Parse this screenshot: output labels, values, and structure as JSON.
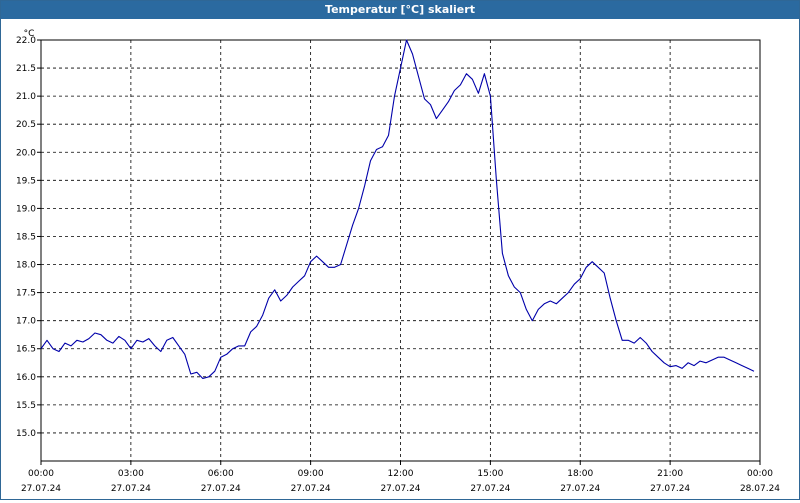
{
  "window": {
    "title": "Temperatur [°C] skaliert"
  },
  "chart_data": {
    "type": "line",
    "title": "Temperatur [°C] skaliert",
    "ylabel": "°C",
    "xlabel": "",
    "ylim": [
      14.5,
      22.0
    ],
    "yticks": [
      15.0,
      15.5,
      16.0,
      16.5,
      17.0,
      17.5,
      18.0,
      18.5,
      19.0,
      19.5,
      20.0,
      20.5,
      21.0,
      21.5,
      22.0
    ],
    "xlim": [
      0,
      24
    ],
    "xticks": [
      {
        "time": "00:00",
        "date": "27.07.24"
      },
      {
        "time": "03:00",
        "date": "27.07.24"
      },
      {
        "time": "06:00",
        "date": "27.07.24"
      },
      {
        "time": "09:00",
        "date": "27.07.24"
      },
      {
        "time": "12:00",
        "date": "27.07.24"
      },
      {
        "time": "15:00",
        "date": "27.07.24"
      },
      {
        "time": "18:00",
        "date": "27.07.24"
      },
      {
        "time": "21:00",
        "date": "27.07.24"
      },
      {
        "time": "00:00",
        "date": "28.07.24"
      }
    ],
    "grid": true,
    "line_color": "#0000aa",
    "series": [
      {
        "x": [
          0.0,
          0.2,
          0.4,
          0.6,
          0.8,
          1.0,
          1.2,
          1.4,
          1.6,
          1.8,
          2.0,
          2.2,
          2.4,
          2.6,
          2.8,
          3.0,
          3.2,
          3.4,
          3.6,
          3.8,
          4.0,
          4.2,
          4.4,
          4.6,
          4.8,
          5.0,
          5.2,
          5.4,
          5.6,
          5.8,
          6.0,
          6.2,
          6.4,
          6.6,
          6.8,
          7.0,
          7.2,
          7.4,
          7.6,
          7.8,
          8.0,
          8.2,
          8.4,
          8.6,
          8.8,
          9.0,
          9.2,
          9.4,
          9.6,
          9.8,
          10.0,
          10.2,
          10.4,
          10.6,
          10.8,
          11.0,
          11.2,
          11.4,
          11.6,
          11.8,
          12.0,
          12.2,
          12.4,
          12.6,
          12.8,
          13.0,
          13.2,
          13.4,
          13.6,
          13.8,
          14.0,
          14.2,
          14.4,
          14.6,
          14.8,
          15.0,
          15.2,
          15.4,
          15.6,
          15.8,
          16.0,
          16.2,
          16.4,
          16.6,
          16.8,
          17.0,
          17.2,
          17.4,
          17.6,
          17.8,
          18.0,
          18.2,
          18.4,
          18.6,
          18.8,
          19.0,
          19.2,
          19.4,
          19.6,
          19.8,
          20.0,
          20.2,
          20.4,
          20.6,
          20.8,
          21.0,
          21.2,
          21.4,
          21.6,
          21.8,
          22.0,
          22.2,
          22.4,
          22.6,
          22.8,
          23.0,
          23.2,
          23.4,
          23.6,
          23.8
        ],
        "y": [
          16.5,
          16.65,
          16.5,
          16.45,
          16.6,
          16.55,
          16.65,
          16.62,
          16.68,
          16.78,
          16.75,
          16.65,
          16.6,
          16.72,
          16.65,
          16.5,
          16.65,
          16.62,
          16.68,
          16.55,
          16.45,
          16.65,
          16.7,
          16.55,
          16.4,
          16.05,
          16.08,
          15.97,
          16.0,
          16.1,
          16.35,
          16.4,
          16.5,
          16.55,
          16.55,
          16.8,
          16.9,
          17.1,
          17.4,
          17.55,
          17.35,
          17.45,
          17.6,
          17.7,
          17.8,
          18.05,
          18.15,
          18.05,
          17.95,
          17.95,
          18.0,
          18.35,
          18.7,
          19.0,
          19.4,
          19.85,
          20.05,
          20.1,
          20.3,
          21.0,
          21.5,
          22.0,
          21.75,
          21.35,
          20.95,
          20.85,
          20.6,
          20.75,
          20.9,
          21.1,
          21.2,
          21.4,
          21.3,
          21.05,
          21.4,
          21.0,
          19.5,
          18.2,
          17.8,
          17.6,
          17.5,
          17.2,
          17.0,
          17.2,
          17.3,
          17.35,
          17.3,
          17.4,
          17.5,
          17.65,
          17.75,
          17.95,
          18.05,
          17.95,
          17.85,
          17.4,
          17.0,
          16.65,
          16.65,
          16.6,
          16.7,
          16.6,
          16.45,
          16.35,
          16.25,
          16.18,
          16.2,
          16.15,
          16.25,
          16.2,
          16.28,
          16.25,
          16.3,
          16.35,
          16.35,
          16.3,
          16.25,
          16.2,
          16.15,
          16.1
        ]
      }
    ]
  }
}
